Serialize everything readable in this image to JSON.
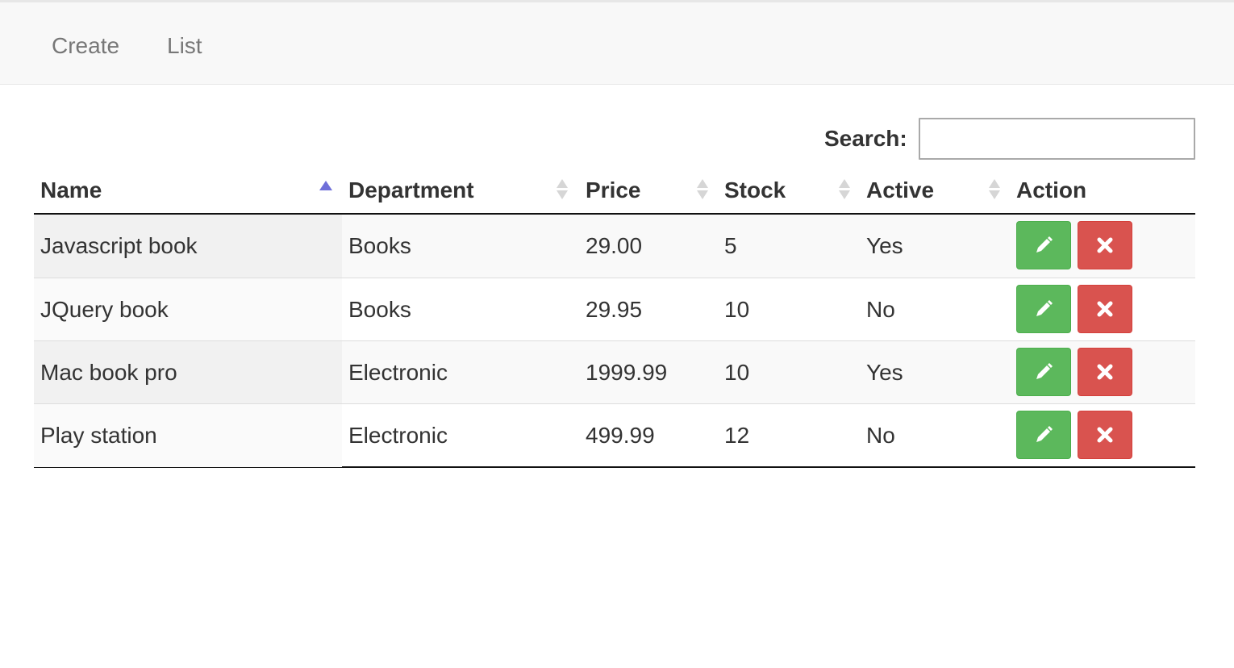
{
  "nav": {
    "create_label": "Create",
    "list_label": "List"
  },
  "search": {
    "label": "Search:",
    "value": "",
    "placeholder": ""
  },
  "table": {
    "columns": [
      "Name",
      "Department",
      "Price",
      "Stock",
      "Active",
      "Action"
    ],
    "sorted_column": "Name",
    "sort_direction": "ascending",
    "rows": [
      {
        "name": "Javascript book",
        "department": "Books",
        "price": "29.00",
        "stock": "5",
        "active": "Yes"
      },
      {
        "name": "JQuery book",
        "department": "Books",
        "price": "29.95",
        "stock": "10",
        "active": "No"
      },
      {
        "name": "Mac book pro",
        "department": "Electronic",
        "price": "1999.99",
        "stock": "10",
        "active": "Yes"
      },
      {
        "name": "Play station",
        "department": "Electronic",
        "price": "499.99",
        "stock": "12",
        "active": "No"
      }
    ],
    "row_actions": [
      {
        "name": "edit",
        "icon": "pencil-icon",
        "color": "#5cb85c"
      },
      {
        "name": "delete",
        "icon": "close-icon",
        "color": "#d9534f"
      }
    ]
  },
  "colors": {
    "navbar_bg": "#f8f8f8",
    "sort_active": "#6f6fd9",
    "sort_inactive": "#d6d6d6"
  }
}
